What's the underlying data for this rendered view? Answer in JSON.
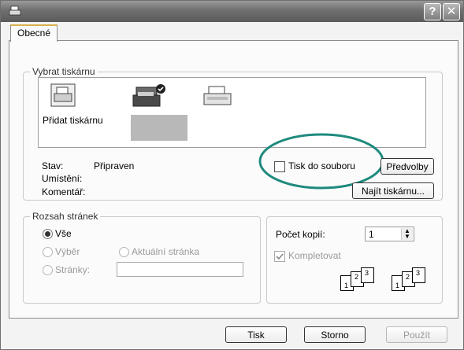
{
  "titlebar": {
    "help_label": "?",
    "close_label": "✕"
  },
  "tabs": {
    "general": "Obecné"
  },
  "select_printer": {
    "legend": "Vybrat tiskárnu",
    "add_printer_label": "Přidat tiskárnu",
    "status_label": "Stav:",
    "status_value": "Připraven",
    "location_label": "Umístění:",
    "comment_label": "Komentář:",
    "print_to_file_label": "Tisk do souboru",
    "preferences_button": "Předvolby",
    "find_printer_button": "Najít tiskárnu..."
  },
  "page_range": {
    "legend": "Rozsah stránek",
    "all_label": "Vše",
    "selection_label": "Výběr",
    "current_page_label": "Aktuální stránka",
    "pages_label": "Stránky:",
    "pages_value": ""
  },
  "copies": {
    "count_label": "Počet kopií:",
    "count_value": "1",
    "collate_label": "Kompletovat",
    "collate_page_labels": [
      "1",
      "2",
      "3"
    ]
  },
  "buttons": {
    "print": "Tisk",
    "cancel": "Storno",
    "apply": "Použít"
  },
  "colors": {
    "annotation": "#1e8a7e",
    "titlebar": "#6f6f6f"
  }
}
